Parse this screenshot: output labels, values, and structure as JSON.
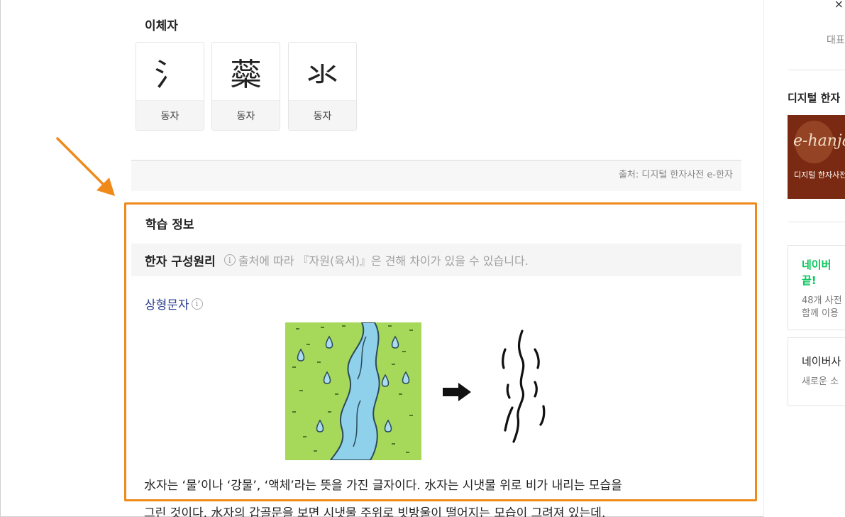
{
  "variants": {
    "title": "이체자",
    "items": [
      {
        "glyph": "氵",
        "label": "동자"
      },
      {
        "glyph": "蘂",
        "label": "동자"
      },
      {
        "glyph": "氺",
        "label": "동자"
      }
    ]
  },
  "source": {
    "text": "출처: 디지털 한자사전 e-한자"
  },
  "study": {
    "title": "학습 정보",
    "principle_heading": "한자 구성원리",
    "principle_info_icon": "i",
    "principle_note": "출처에 따라 『자원(육서)』은 견해 차이가 있을 수 있습니다.",
    "category": "상형문자",
    "category_info_icon": "i",
    "description_line1": "水자는 ‘물’이나 ‘강물’, ‘액체’라는 뜻을 가진 글자이다. 水자는 시냇물 위로 비가 내리는 모습을",
    "description_line2": "그린 것이다. 水자의 갑골문을 보면 시냇물 주위로 빗방울이 떨어지는   모습이 그려져 있는데,"
  },
  "sidebar": {
    "close": "×",
    "rep_label": "대표",
    "dict_title": "디지털 한자",
    "banner_logo": "e-hanja",
    "banner_caption": "디지털 한자사전",
    "card1_title": "네이버",
    "card1_title2": "끝!",
    "card1_sub1": "48개 사전",
    "card1_sub2": "함께 이용",
    "card2_title": "네이버사",
    "card2_sub": "새로운 소",
    "accent_green": "#03c75a"
  },
  "colors": {
    "highlight": "#ef8a1a",
    "category_link": "#2a3d8f",
    "river": "#8fd0ea",
    "grass": "#a6d85a"
  }
}
